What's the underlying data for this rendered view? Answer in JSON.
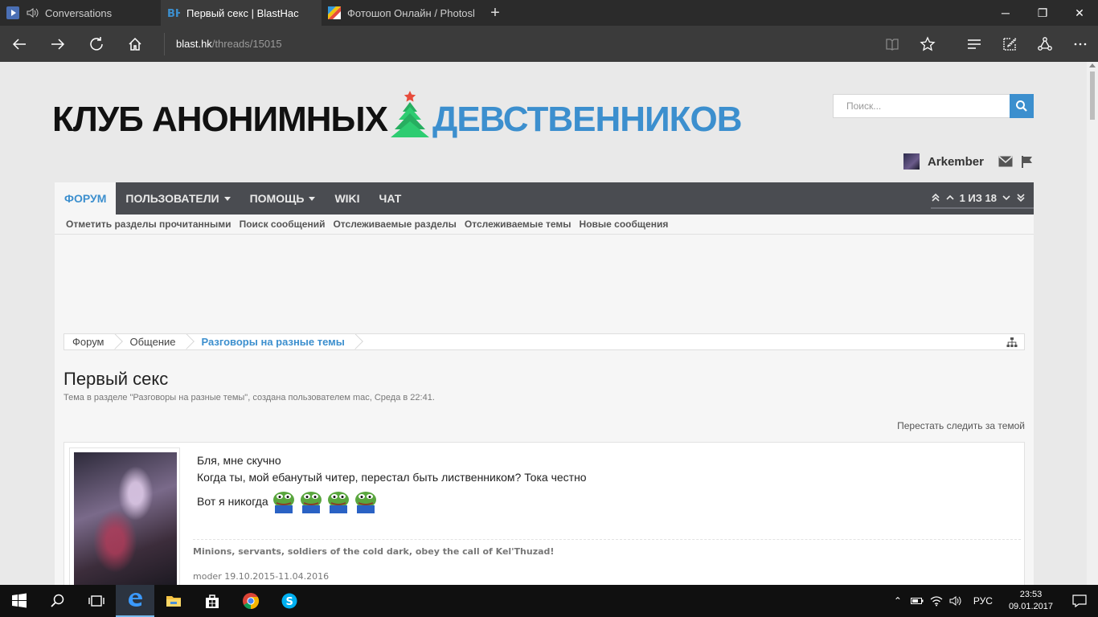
{
  "browser": {
    "tabs": [
      {
        "title": "Conversations",
        "active": false
      },
      {
        "title": "Первый секс | BlastHac",
        "active": true
      },
      {
        "title": "Фотошоп Онлайн / Photosl",
        "active": false
      }
    ],
    "url_host": "blast.hk",
    "url_path": "/threads/15015"
  },
  "site": {
    "logo_black": "КЛУБ АНОНИМНЫХ",
    "logo_blue": "ДЕВСТВЕННИКОВ",
    "search_placeholder": "Поиск...",
    "username": "Arkember",
    "accent": "#3c8fce"
  },
  "nav": {
    "tabs": [
      "ФОРУМ",
      "ПОЛЬЗОВАТЕЛИ",
      "ПОМОЩЬ",
      "WIKI",
      "ЧАТ"
    ],
    "pager": "1 ИЗ 18",
    "subnav": [
      "Отметить разделы прочитанными",
      "Поиск сообщений",
      "Отслеживаемые разделы",
      "Отслеживаемые темы",
      "Новые сообщения"
    ]
  },
  "breadcrumb": [
    "Форум",
    "Общение",
    "Разговоры на разные темы"
  ],
  "thread": {
    "title": "Первый секс",
    "description": "Тема в разделе \"Разговоры на разные темы\", создана пользователем mac, Среда в 22:41.",
    "unwatch": "Перестать следить за темой"
  },
  "post": {
    "lines": [
      "Бля, мне скучно",
      "Когда ты, мой ебанутый читер, перестал быть лиственником? Тока честно",
      "Вот я никогда"
    ],
    "smilies": [
      "pepe-icon",
      "pepe-icon",
      "pepe-icon",
      "pepe-icon"
    ],
    "signature_quote": "Minions, servants, soldiers of the cold dark, obey the call of Kel'Thuzad!",
    "signature_note": "moder 19.10.2015-11.04.2016"
  },
  "taskbar": {
    "lang": "РУС",
    "time": "23:53",
    "date": "09.01.2017"
  }
}
